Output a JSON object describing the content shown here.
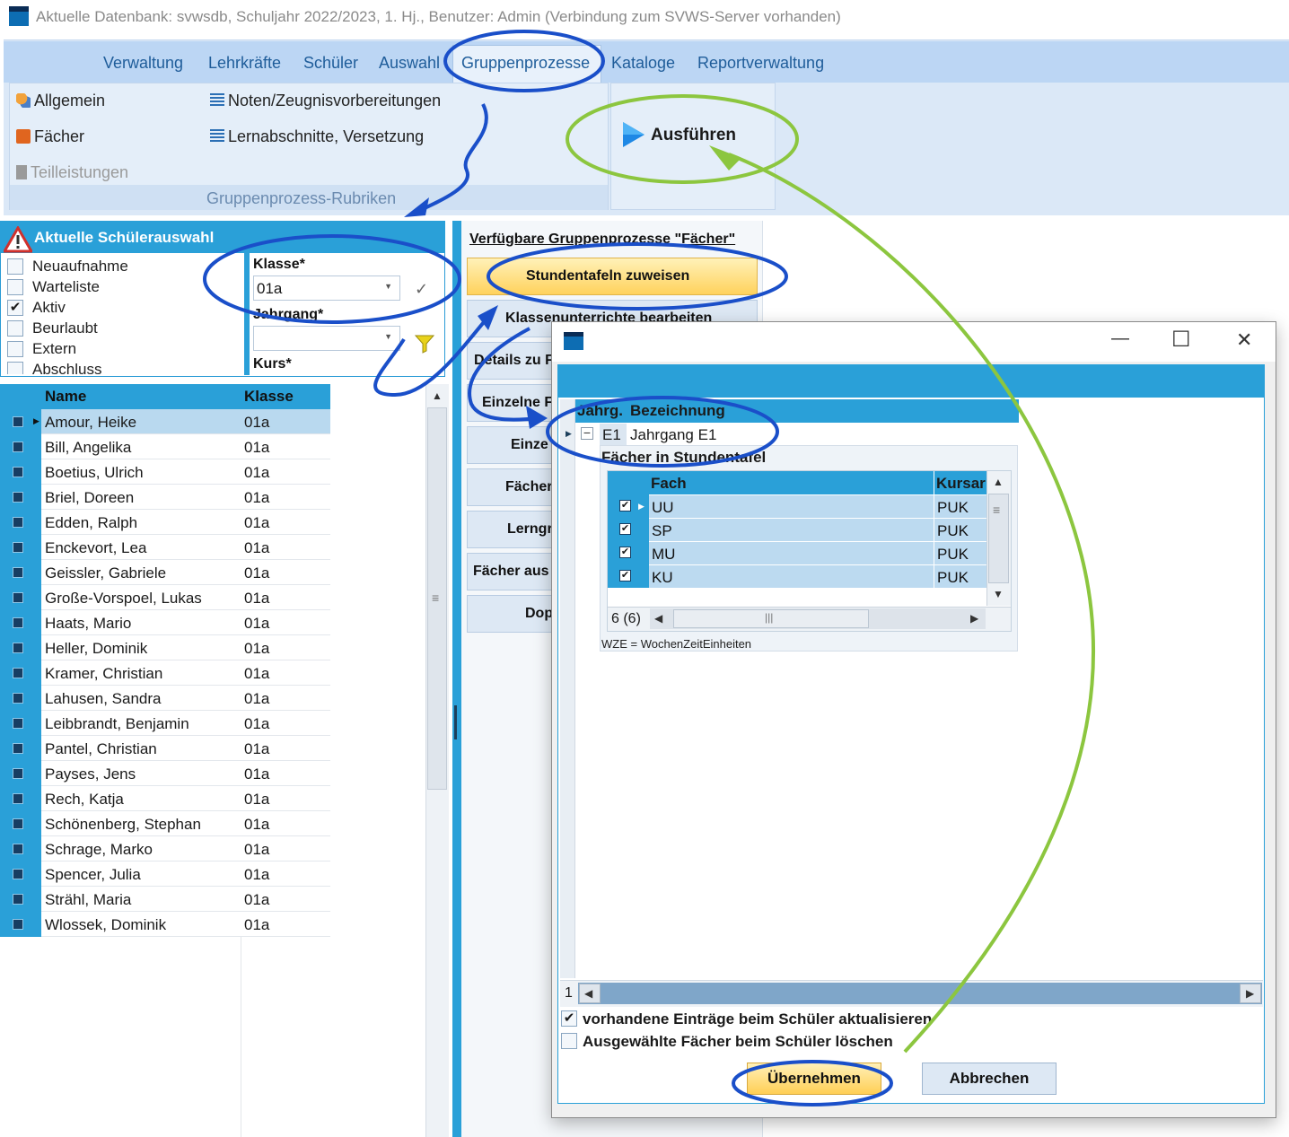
{
  "window": {
    "title": "Aktuelle Datenbank: svwsdb, Schuljahr 2022/2023, 1. Hj., Benutzer: Admin (Verbindung zum SVWS-Server vorhanden)"
  },
  "ribbon": {
    "tabs": [
      "Verwaltung",
      "Lehrkräfte",
      "Schüler",
      "Auswahl",
      "Gruppenprozesse",
      "Kataloge",
      "Reportverwaltung"
    ],
    "active_tab": "Gruppenprozesse",
    "buttons": {
      "allgemein": "Allgemein",
      "faecher": "Fächer",
      "teilleistungen": "Teilleistungen",
      "noten": "Noten/Zeugnisvorbereitungen",
      "lernabschnitte": "Lernabschnitte, Versetzung",
      "ausfuehren": "Ausführen"
    },
    "group_caption": "Gruppenprozess-Rubriken"
  },
  "selection": {
    "title": "Aktuelle Schülerauswahl",
    "status_filters": [
      {
        "label": "Neuaufnahme",
        "checked": false
      },
      {
        "label": "Warteliste",
        "checked": false
      },
      {
        "label": "Aktiv",
        "checked": true
      },
      {
        "label": "Beurlaubt",
        "checked": false
      },
      {
        "label": "Extern",
        "checked": false
      },
      {
        "label": "Abschluss",
        "checked": false
      }
    ],
    "klasse_label": "Klasse*",
    "klasse_value": "01a",
    "jahrgang_label": "Jahrgang*",
    "jahrgang_value": "",
    "kurs_label": "Kurs*"
  },
  "students": {
    "columns": [
      "Name",
      "Klasse"
    ],
    "rows": [
      [
        "Amour, Heike",
        "01a"
      ],
      [
        "Bill, Angelika",
        "01a"
      ],
      [
        "Boetius, Ulrich",
        "01a"
      ],
      [
        "Briel, Doreen",
        "01a"
      ],
      [
        "Edden, Ralph",
        "01a"
      ],
      [
        "Enckevort, Lea",
        "01a"
      ],
      [
        "Geissler, Gabriele",
        "01a"
      ],
      [
        "Große-Vorspoel, Lukas",
        "01a"
      ],
      [
        "Haats, Mario",
        "01a"
      ],
      [
        "Heller, Dominik",
        "01a"
      ],
      [
        "Kramer, Christian",
        "01a"
      ],
      [
        "Lahusen, Sandra",
        "01a"
      ],
      [
        "Leibbrandt, Benjamin",
        "01a"
      ],
      [
        "Pantel, Christian",
        "01a"
      ],
      [
        "Payses, Jens",
        "01a"
      ],
      [
        "Rech, Katja",
        "01a"
      ],
      [
        "Schönenberg, Stephan",
        "01a"
      ],
      [
        "Schrage, Marko",
        "01a"
      ],
      [
        "Spencer, Julia",
        "01a"
      ],
      [
        "Strähl, Maria",
        "01a"
      ],
      [
        "Wlossek, Dominik",
        "01a"
      ]
    ],
    "selected_index": 0
  },
  "processes": {
    "title": "Verfügbare Gruppenprozesse \"Fächer\"",
    "buttons": [
      "Stundentafeln zuweisen",
      "Klassenunterrichte bearbeiten",
      "Details zu F",
      "Einzelne F",
      "Einze",
      "Fächer",
      "Lerngr",
      "Fächer aus",
      "Dop"
    ],
    "active": "Stundentafeln zuweisen"
  },
  "dialog": {
    "master_columns": [
      "Jahrg.",
      "Bezeichnung"
    ],
    "master_row": {
      "jahrgang": "E1",
      "bezeichnung": "Jahrgang E1",
      "expander": "−"
    },
    "detail_title": "Fächer in Stundentafel",
    "detail_columns": [
      "Fach",
      "Kursar"
    ],
    "detail_rows": [
      {
        "fach": "UU",
        "kursart": "PUK",
        "checked": true
      },
      {
        "fach": "SP",
        "kursart": "PUK",
        "checked": true
      },
      {
        "fach": "MU",
        "kursart": "PUK",
        "checked": true
      },
      {
        "fach": "KU",
        "kursart": "PUK",
        "checked": true
      }
    ],
    "detail_count": "6 (6)",
    "legend": "WZE = WochenZeitEinheiten",
    "outer_count": "1",
    "options": [
      {
        "label": "vorhandene Einträge beim Schüler aktualisieren",
        "checked": true
      },
      {
        "label": "Ausgewählte Fächer beim Schüler löschen",
        "checked": false
      }
    ],
    "ok_label": "Übernehmen",
    "cancel_label": "Abbrechen",
    "window_controls": {
      "minimize": "—",
      "maximize": "☐",
      "close": "✕"
    }
  },
  "colors": {
    "accent": "#2aa0d8",
    "annotation_blue": "#1a4fc9",
    "annotation_green": "#8cc63f",
    "highlight_yellow": "#ffd25c"
  }
}
